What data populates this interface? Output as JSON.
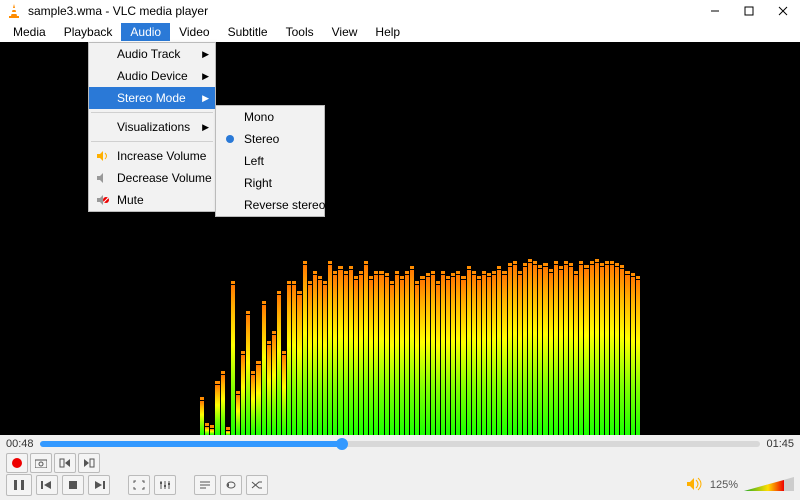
{
  "title": "sample3.wma - VLC media player",
  "menu": [
    "Media",
    "Playback",
    "Audio",
    "Video",
    "Subtitle",
    "Tools",
    "View",
    "Help"
  ],
  "menu_active_index": 2,
  "audio_menu": {
    "items": [
      {
        "label": "Audio Track",
        "arrow": true
      },
      {
        "label": "Audio Device",
        "arrow": true
      },
      {
        "label": "Stereo Mode",
        "arrow": true,
        "hi": true
      },
      {
        "sep": true
      },
      {
        "label": "Visualizations",
        "arrow": true
      },
      {
        "sep": true
      },
      {
        "label": "Increase Volume",
        "icon": "vol-up"
      },
      {
        "label": "Decrease Volume",
        "icon": "vol-down"
      },
      {
        "label": "Mute",
        "icon": "mute"
      }
    ]
  },
  "stereo_menu": {
    "items": [
      {
        "label": "Mono"
      },
      {
        "label": "Stereo",
        "selected": true
      },
      {
        "label": "Left"
      },
      {
        "label": "Right"
      },
      {
        "label": "Reverse stereo"
      }
    ]
  },
  "time_current": "00:48",
  "time_total": "01:45",
  "volume_percent": "125%",
  "viz_bars": [
    34,
    8,
    6,
    50,
    60,
    4,
    150,
    40,
    80,
    120,
    60,
    70,
    130,
    90,
    100,
    140,
    80,
    150,
    150,
    140,
    170,
    150,
    160,
    155,
    150,
    170,
    160,
    165,
    160,
    165,
    155,
    160,
    170,
    155,
    160,
    160,
    158,
    150,
    160,
    155,
    160,
    165,
    150,
    155,
    158,
    160,
    150,
    160,
    155,
    158,
    160,
    155,
    165,
    160,
    155,
    160,
    158,
    160,
    165,
    160,
    168,
    170,
    160,
    168,
    172,
    170,
    166,
    168,
    162,
    170,
    165,
    170,
    168,
    160,
    170,
    166,
    170,
    172,
    168,
    170,
    170,
    168,
    166,
    160,
    158,
    155
  ]
}
